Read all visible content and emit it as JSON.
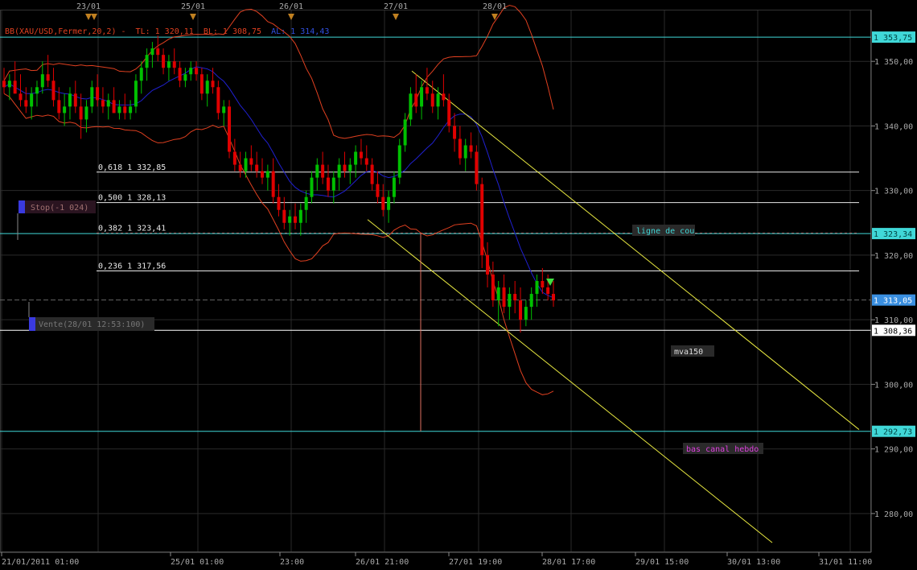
{
  "chart_data": {
    "type": "candlestick",
    "indicator_label": {
      "bb": "BB(XAU/USD,Fermer,20,2) -",
      "tl": "TL: 1 320,11",
      "bl": "BL: 1 308,75",
      "al": "AL: 1 314,43"
    },
    "y_axis": {
      "ylim": [
        1274,
        1358
      ],
      "ticks": [
        1280,
        1290,
        1300,
        1310,
        1320,
        1330,
        1340,
        1350
      ],
      "tick_labels": [
        "1 280,00",
        "1 290,00",
        "1 300,00",
        "1 310,00",
        "1 320,00",
        "1 330,00",
        "1 340,00",
        "1 350,00"
      ]
    },
    "top_dates": [
      "23/01",
      "25/01",
      "26/01",
      "27/01",
      "28/01"
    ],
    "bottom_dates": [
      "21/01/2011 01:00",
      "25/01 01:00",
      "23:00",
      "26/01 21:00",
      "27/01 19:00",
      "28/01 17:00",
      "29/01 15:00",
      "30/01 13:00",
      "31/01 11:00"
    ],
    "horizontal_lines": [
      {
        "value": 1353.75,
        "color": "#40d8d8",
        "price_label": "1 353,75"
      },
      {
        "value": 1323.34,
        "color": "#40d8d8",
        "price_label": "1 323,34"
      },
      {
        "value": 1292.73,
        "color": "#40d8d8",
        "price_label": "1 292,73"
      },
      {
        "value": 1308.36,
        "color": "#ffffff",
        "price_label": "1 308,36"
      },
      {
        "value": 1313.05,
        "color": "#3a8fe0",
        "price_label": "1 313,05"
      }
    ],
    "fibonacci": [
      {
        "value": 1332.85,
        "label": "0,618 1 332,85"
      },
      {
        "value": 1328.13,
        "label": "0,500 1 328,13"
      },
      {
        "value": 1323.41,
        "label": "0,382 1 323,41"
      },
      {
        "value": 1317.56,
        "label": "0,236 1 317,56"
      }
    ],
    "annotations": {
      "stop": "Stop(-1 024)",
      "vente": "Vente(28/01 12:53:100)",
      "ligne": "ligne de cou",
      "mva": "mva150",
      "bas": "bas canal hebdo"
    },
    "colors": {
      "bull": "#00c000",
      "bear": "#e00000",
      "bollinger": "#e04020",
      "mva": "#2020d0",
      "channel": "#e8e840"
    },
    "candles_ohlc": [
      [
        1347,
        1349,
        1345,
        1346
      ],
      [
        1346,
        1348,
        1344,
        1347
      ],
      [
        1347,
        1350,
        1345,
        1345
      ],
      [
        1345,
        1348,
        1343,
        1344
      ],
      [
        1344,
        1346,
        1342,
        1343
      ],
      [
        1343,
        1346,
        1341,
        1345
      ],
      [
        1345,
        1347,
        1343,
        1346
      ],
      [
        1346,
        1350,
        1345,
        1348
      ],
      [
        1348,
        1351,
        1346,
        1347
      ],
      [
        1347,
        1349,
        1343,
        1344
      ],
      [
        1344,
        1346,
        1341,
        1342
      ],
      [
        1342,
        1345,
        1340,
        1343
      ],
      [
        1343,
        1346,
        1341,
        1345
      ],
      [
        1345,
        1347,
        1342,
        1343
      ],
      [
        1343,
        1345,
        1338,
        1341
      ],
      [
        1341,
        1344,
        1339,
        1343
      ],
      [
        1343,
        1347,
        1342,
        1346
      ],
      [
        1346,
        1348,
        1343,
        1344
      ],
      [
        1344,
        1346,
        1342,
        1343
      ],
      [
        1343,
        1345,
        1341,
        1344
      ],
      [
        1344,
        1346,
        1342,
        1342
      ],
      [
        1342,
        1344,
        1341,
        1343
      ],
      [
        1343,
        1345,
        1341,
        1342
      ],
      [
        1342,
        1344,
        1341,
        1343
      ],
      [
        1343,
        1348,
        1342,
        1347
      ],
      [
        1347,
        1350,
        1345,
        1349
      ],
      [
        1349,
        1352,
        1347,
        1351
      ],
      [
        1351,
        1353,
        1349,
        1352
      ],
      [
        1352,
        1354,
        1350,
        1351
      ],
      [
        1351,
        1352,
        1348,
        1349
      ],
      [
        1349,
        1351,
        1347,
        1350
      ],
      [
        1350,
        1352,
        1348,
        1349
      ],
      [
        1349,
        1350,
        1346,
        1347
      ],
      [
        1347,
        1349,
        1346,
        1348
      ],
      [
        1348,
        1350,
        1347,
        1349
      ],
      [
        1349,
        1350,
        1347,
        1348
      ],
      [
        1348,
        1349,
        1344,
        1345
      ],
      [
        1345,
        1348,
        1343,
        1347
      ],
      [
        1347,
        1349,
        1345,
        1346
      ],
      [
        1346,
        1347,
        1341,
        1342
      ],
      [
        1342,
        1344,
        1340,
        1343
      ],
      [
        1343,
        1344,
        1335,
        1336
      ],
      [
        1336,
        1338,
        1333,
        1334
      ],
      [
        1334,
        1336,
        1332,
        1333
      ],
      [
        1333,
        1336,
        1332,
        1335
      ],
      [
        1335,
        1337,
        1333,
        1334
      ],
      [
        1334,
        1336,
        1332,
        1333
      ],
      [
        1333,
        1335,
        1331,
        1332
      ],
      [
        1332,
        1334,
        1330,
        1333
      ],
      [
        1333,
        1335,
        1328,
        1329
      ],
      [
        1329,
        1331,
        1326,
        1327
      ],
      [
        1327,
        1329,
        1324,
        1325
      ],
      [
        1325,
        1327,
        1323,
        1326
      ],
      [
        1326,
        1328,
        1324,
        1325
      ],
      [
        1325,
        1328,
        1323,
        1327
      ],
      [
        1327,
        1330,
        1325,
        1329
      ],
      [
        1329,
        1333,
        1328,
        1332
      ],
      [
        1332,
        1335,
        1330,
        1334
      ],
      [
        1334,
        1336,
        1331,
        1332
      ],
      [
        1332,
        1334,
        1329,
        1330
      ],
      [
        1330,
        1333,
        1328,
        1332
      ],
      [
        1332,
        1335,
        1330,
        1334
      ],
      [
        1334,
        1336,
        1332,
        1333
      ],
      [
        1333,
        1335,
        1331,
        1334
      ],
      [
        1334,
        1337,
        1332,
        1336
      ],
      [
        1336,
        1338,
        1334,
        1335
      ],
      [
        1335,
        1337,
        1333,
        1334
      ],
      [
        1334,
        1335,
        1330,
        1331
      ],
      [
        1331,
        1333,
        1328,
        1329
      ],
      [
        1329,
        1331,
        1326,
        1327
      ],
      [
        1327,
        1330,
        1325,
        1329
      ],
      [
        1329,
        1333,
        1328,
        1332
      ],
      [
        1332,
        1338,
        1331,
        1337
      ],
      [
        1337,
        1342,
        1336,
        1341
      ],
      [
        1341,
        1346,
        1340,
        1345
      ],
      [
        1345,
        1348,
        1342,
        1343
      ],
      [
        1343,
        1347,
        1341,
        1346
      ],
      [
        1346,
        1349,
        1344,
        1345
      ],
      [
        1345,
        1347,
        1342,
        1343
      ],
      [
        1343,
        1346,
        1341,
        1345
      ],
      [
        1345,
        1348,
        1343,
        1344
      ],
      [
        1344,
        1345,
        1339,
        1340
      ],
      [
        1340,
        1342,
        1336,
        1338
      ],
      [
        1338,
        1340,
        1334,
        1335
      ],
      [
        1335,
        1338,
        1333,
        1337
      ],
      [
        1337,
        1339,
        1335,
        1336
      ],
      [
        1336,
        1337,
        1330,
        1331
      ],
      [
        1331,
        1332,
        1318,
        1320
      ],
      [
        1320,
        1322,
        1315,
        1317
      ],
      [
        1317,
        1319,
        1312,
        1313
      ],
      [
        1313,
        1316,
        1309,
        1315
      ],
      [
        1315,
        1317,
        1311,
        1312
      ],
      [
        1312,
        1315,
        1310,
        1314
      ],
      [
        1314,
        1316,
        1311,
        1313
      ],
      [
        1313,
        1315,
        1308,
        1310
      ],
      [
        1310,
        1313,
        1309,
        1312
      ],
      [
        1312,
        1315,
        1310,
        1314
      ],
      [
        1314,
        1317,
        1312,
        1316
      ],
      [
        1316,
        1318,
        1314,
        1315
      ],
      [
        1315,
        1317,
        1313,
        1314
      ],
      [
        1314,
        1316,
        1312,
        1313
      ]
    ]
  }
}
